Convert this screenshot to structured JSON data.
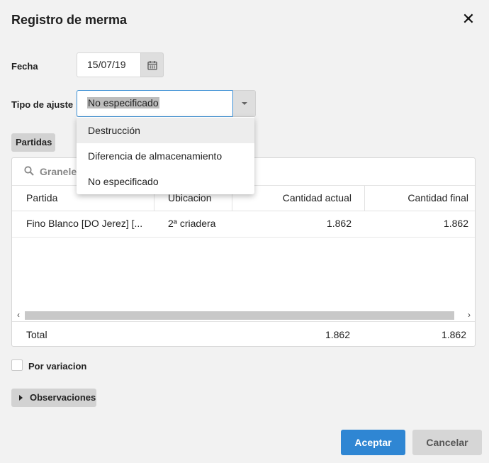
{
  "dialog": {
    "title": "Registro de merma"
  },
  "fecha": {
    "label": "Fecha",
    "value": "15/07/19"
  },
  "tipo_ajuste": {
    "label": "Tipo de ajuste",
    "value": "No especificado",
    "options": [
      "Destrucción",
      "Diferencia de almacenamiento",
      "No especificado"
    ]
  },
  "partidas": {
    "section_label": "Partidas",
    "search_text": "Graneles",
    "columns": [
      "Partida",
      "Ubicacion",
      "Cantidad actual",
      "Cantidad final"
    ],
    "rows": [
      {
        "partida": "Fino Blanco [DO Jerez] [...",
        "ubicacion": "2ª criadera",
        "cantidad_actual": "1.862",
        "cantidad_final": "1.862"
      }
    ],
    "total": {
      "label": "Total",
      "cantidad_actual": "1.862",
      "cantidad_final": "1.862"
    }
  },
  "por_variacion": {
    "label": "Por variacion",
    "checked": false
  },
  "observaciones": {
    "label": "Observaciones"
  },
  "actions": {
    "accept": "Aceptar",
    "cancel": "Cancelar"
  },
  "colors": {
    "primary": "#2f86d3",
    "focus_border": "#3b8fd4",
    "background": "#f2f2f2"
  }
}
